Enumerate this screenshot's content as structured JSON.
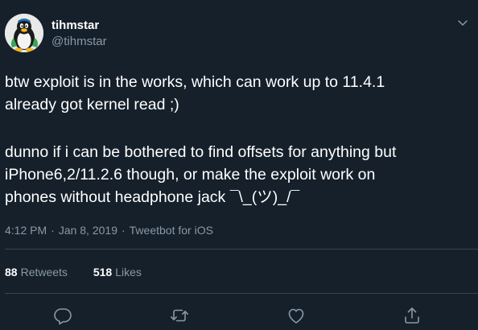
{
  "author": {
    "name": "tihmstar",
    "handle": "@tihmstar"
  },
  "tweet": {
    "line1": "btw exploit is in the works, which can work up to 11.4.1",
    "line2": "already got kernel read ;)",
    "line3": "dunno if i can be bothered to find offsets for anything but",
    "line4": "iPhone6,2/11.2.6 though, or make the exploit work on",
    "line5": "phones without headphone jack ¯\\_(ツ)_/¯"
  },
  "meta": {
    "time": "4:12 PM",
    "date": "Jan 8, 2019",
    "source": "Tweetbot for iOS",
    "separator": "·"
  },
  "stats": {
    "retweets_count": "88",
    "retweets_label": "Retweets",
    "likes_count": "518",
    "likes_label": "Likes"
  },
  "icons": {
    "reply": "reply-icon",
    "retweet": "retweet-icon",
    "like": "like-icon",
    "share": "share-icon",
    "more": "chevron-down-icon"
  },
  "colors": {
    "background": "#15202b",
    "text": "#ffffff",
    "secondary": "#8899a6",
    "divider": "#38444d"
  }
}
